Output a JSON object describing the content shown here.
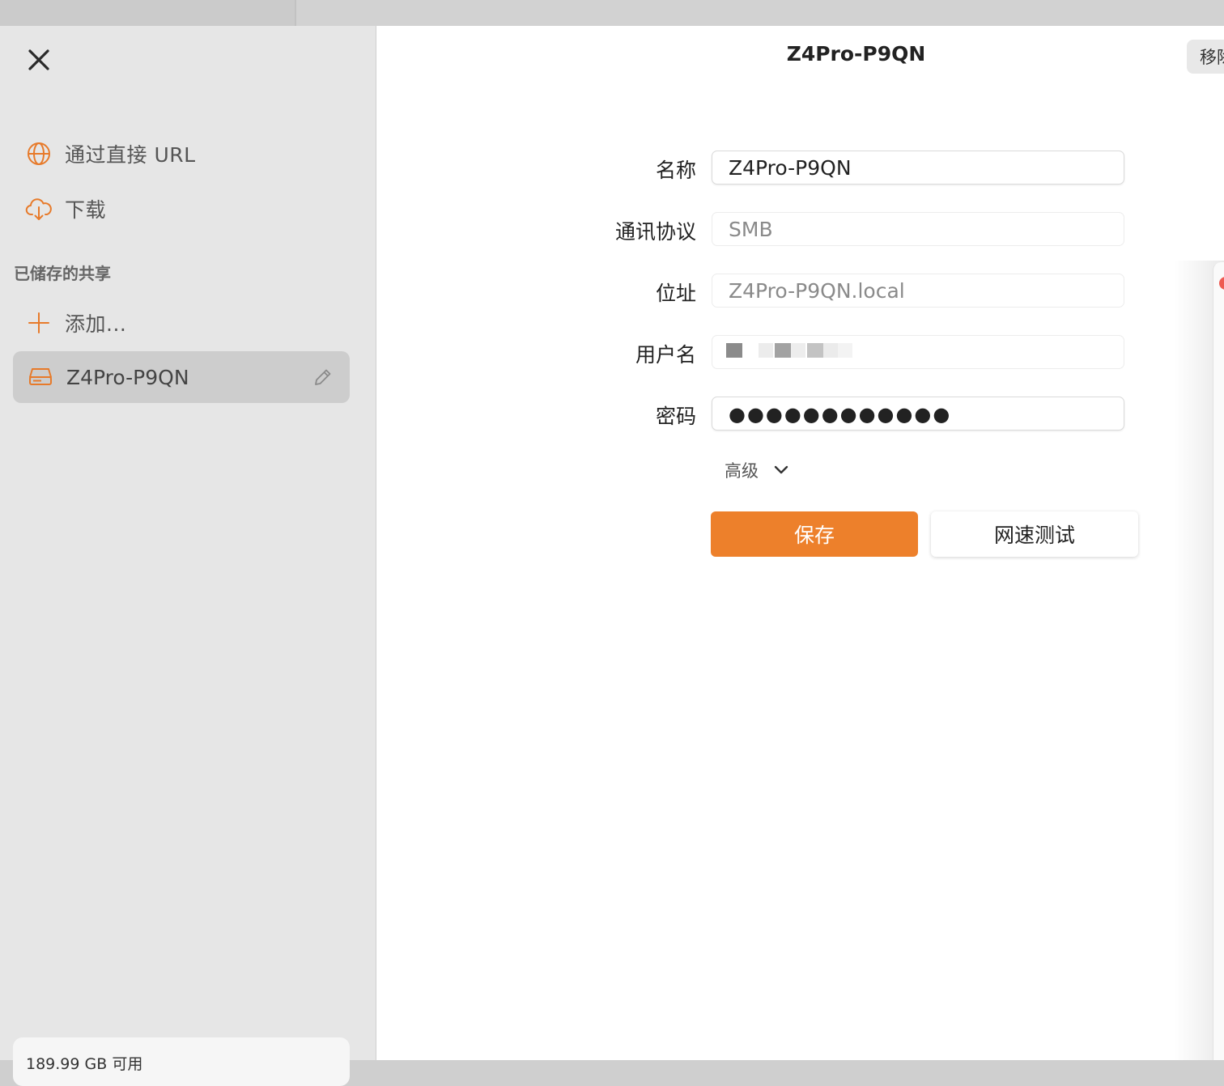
{
  "sidebar": {
    "items": [
      {
        "label": "通过直接 URL",
        "icon": "globe-icon"
      },
      {
        "label": "下载",
        "icon": "cloud-download-icon"
      }
    ],
    "section_title": "已储存的共享",
    "add_label": "添加...",
    "selected_share": "Z4Pro-P9QN",
    "storage": "189.99 GB 可用"
  },
  "header": {
    "title": "Z4Pro-P9QN",
    "remove_label": "移除"
  },
  "form": {
    "name_label": "名称",
    "name_value": "Z4Pro-P9QN",
    "protocol_label": "通讯协议",
    "protocol_value": "SMB",
    "address_label": "位址",
    "address_value": "Z4Pro-P9QN.local",
    "username_label": "用户名",
    "password_label": "密码",
    "password_value": "●●●●●●●●●●●●",
    "advanced_label": "高级"
  },
  "buttons": {
    "save": "保存",
    "speed_test": "网速测试"
  },
  "colors": {
    "accent": "#ed802b",
    "sidebar_bg": "#e6e6e6",
    "selected_bg": "#cdcdcd"
  }
}
